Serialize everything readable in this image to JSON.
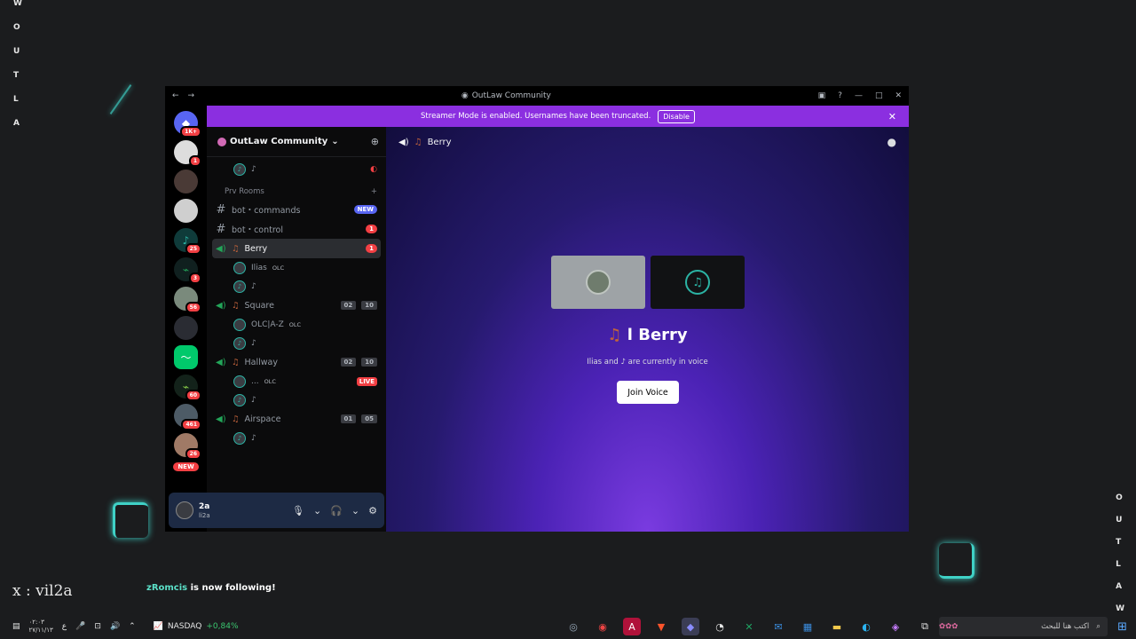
{
  "overlay": {
    "left_letters": [
      "W",
      "O",
      "U",
      "T",
      "L",
      "A"
    ],
    "right_letters": [
      "O",
      "U",
      "T",
      "L",
      "A",
      "W"
    ],
    "handle": "x : vil2a",
    "follow_name": "zRomcis",
    "follow_text": "is now following!"
  },
  "window": {
    "title": "OutLaw Community",
    "streamer_banner": "Streamer Mode is enabled. Usernames have been truncated.",
    "disable_label": "Disable"
  },
  "servers": [
    {
      "badge": "1K+"
    },
    {
      "badge": "1"
    },
    {
      "badge": ""
    },
    {
      "badge": ""
    },
    {
      "badge": "25"
    },
    {
      "badge": "3"
    },
    {
      "badge": "56"
    },
    {
      "badge": ""
    },
    {
      "badge": ""
    },
    {
      "badge": "60"
    },
    {
      "badge": "461"
    },
    {
      "badge": "26"
    }
  ],
  "servers_new": "NEW",
  "guild": {
    "name": "OutLaw Community"
  },
  "channels": {
    "category": "Prv Rooms",
    "bot_commands": "bot・commands",
    "bot_commands_pill": "NEW",
    "bot_control": "bot・control",
    "bot_control_pill": "1",
    "berry": "Berry",
    "berry_pill": "1",
    "berry_users": [
      {
        "name": "Ilias",
        "tag": "OLC"
      },
      {
        "name": "♪",
        "tag": ""
      }
    ],
    "square": "Square",
    "square_count": "02",
    "square_limit": "10",
    "square_users": [
      {
        "name": "OLC|A-Z",
        "tag": "OLC"
      },
      {
        "name": "♪",
        "tag": ""
      }
    ],
    "hallway": "Hallway",
    "hallway_count": "02",
    "hallway_limit": "10",
    "hallway_users": [
      {
        "name": "...",
        "tag": "OLC",
        "live": "LIVE"
      },
      {
        "name": "♪",
        "tag": ""
      }
    ],
    "airspace": "Airspace",
    "airspace_count": "01",
    "airspace_limit": "05",
    "airspace_users": [
      {
        "name": "♪",
        "tag": ""
      }
    ],
    "top_user": "♪"
  },
  "user_panel": {
    "name": "2a",
    "sub": "li2a"
  },
  "main": {
    "channel_name": "Berry",
    "title": "l Berry",
    "subtitle": "Ilias and ♪ are currently in voice",
    "join_label": "Join Voice"
  },
  "taskbar": {
    "clock_line1": "٠٢:٠٣",
    "clock_line2": "٢٧/١١/١٣",
    "lang": "ع",
    "stock_name": "NASDAQ",
    "stock_change": "+0,84%",
    "search_placeholder": "اكتب هنا للبحث"
  },
  "colors": {
    "accent": "#8b2fe0",
    "online": "#23a559",
    "badge_red": "#f23f43",
    "teal": "#2bb3a4"
  }
}
